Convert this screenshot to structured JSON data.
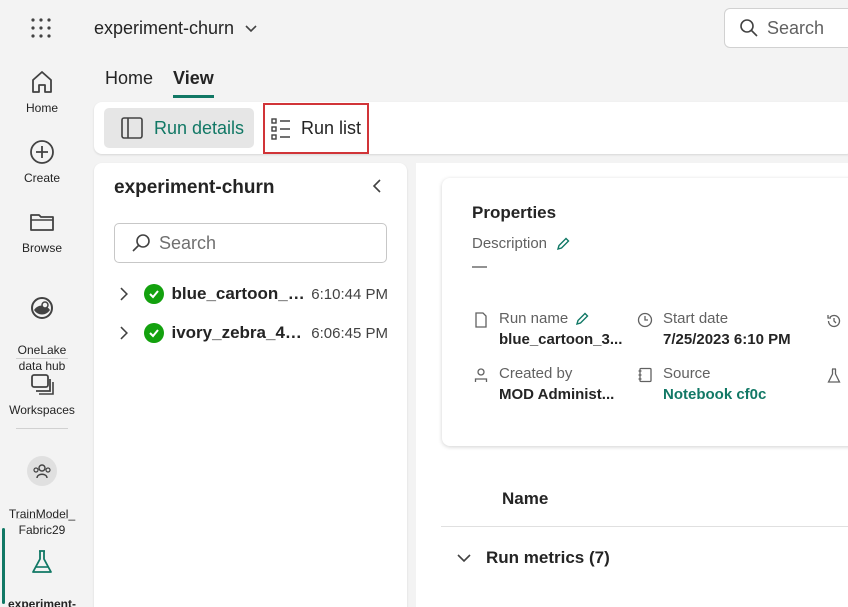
{
  "rail": {
    "items": [
      {
        "label": "Home",
        "icon": "home-icon"
      },
      {
        "label": "Create",
        "icon": "plus-circle-icon"
      },
      {
        "label": "Browse",
        "icon": "folder-icon"
      },
      {
        "label": "OneLake\ndata hub",
        "icon": "onelake-icon"
      },
      {
        "label": "Workspaces",
        "icon": "workspaces-icon"
      },
      {
        "label": "TrainModel_\nFabric29",
        "icon": "workspace-avatar-icon"
      },
      {
        "label": "experiment-\nchurn",
        "icon": "flask-icon"
      }
    ]
  },
  "header": {
    "title": "experiment-churn",
    "search_placeholder": "Search"
  },
  "tabs": [
    {
      "label": "Home",
      "active": false
    },
    {
      "label": "View",
      "active": true
    }
  ],
  "ribbon": {
    "run_details": "Run details",
    "run_list": "Run list"
  },
  "left_panel": {
    "title": "experiment-churn",
    "search_placeholder": "Search",
    "runs": [
      {
        "name": "blue_cartoon_3...",
        "time": "6:10:44 PM"
      },
      {
        "name": "ivory_zebra_4g...",
        "time": "6:06:45 PM"
      }
    ]
  },
  "properties": {
    "title": "Properties",
    "description_label": "Description",
    "description_value": "—",
    "run_name_label": "Run name",
    "run_name_value": "blue_cartoon_3...",
    "start_date_label": "Start date",
    "start_date_value": "7/25/2023 6:10 PM",
    "created_by_label": "Created by",
    "created_by_value": "MOD Administ...",
    "source_label": "Source",
    "source_value": "Notebook cf0c"
  },
  "table": {
    "name_header": "Name",
    "run_metrics": "Run metrics (7)"
  },
  "colors": {
    "accent": "#117865",
    "highlight": "#d13438",
    "success": "#13a10e"
  }
}
